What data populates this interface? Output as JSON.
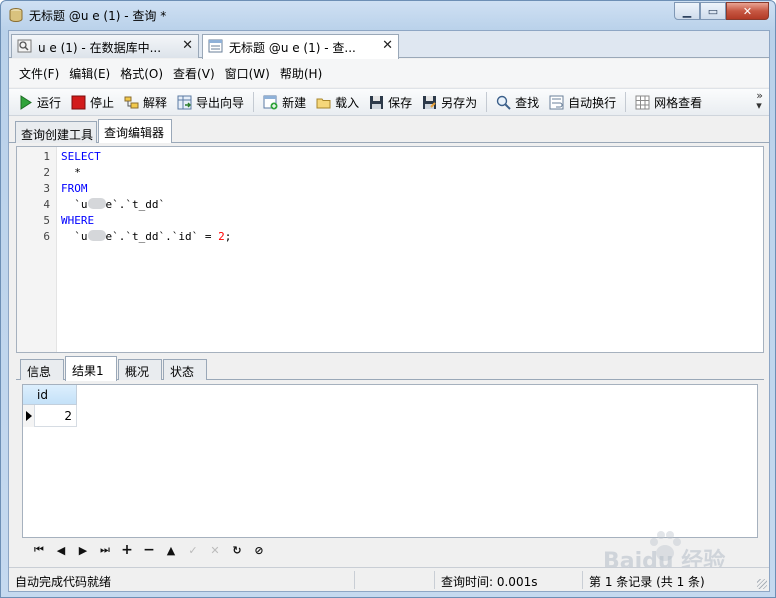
{
  "window": {
    "title": "无标题 @u    e (1) - 查询 *"
  },
  "doc_tabs": [
    {
      "label": "u    e (1) - 在数据库中...",
      "close": "✕"
    },
    {
      "label": "无标题 @u    e (1) - 查...",
      "close": "✕"
    }
  ],
  "menu": [
    "文件(F)",
    "编辑(E)",
    "格式(O)",
    "查看(V)",
    "窗口(W)",
    "帮助(H)"
  ],
  "toolbar": {
    "run": "运行",
    "stop": "停止",
    "explain": "解释",
    "export": "导出向导",
    "new": "新建",
    "load": "载入",
    "save": "保存",
    "save_as": "另存为",
    "find": "查找",
    "wrap": "自动换行",
    "grid_view": "网格查看"
  },
  "sub_tabs": [
    "查询创建工具",
    "查询编辑器"
  ],
  "editor": {
    "line_numbers": [
      "1",
      "2",
      "3",
      "4",
      "5",
      "6"
    ],
    "lines": {
      "l1": "SELECT",
      "l2": "  *",
      "l3": "FROM",
      "l4_pre": "  `u",
      "l4_post": "e`.`t_dd`",
      "l5": "WHERE",
      "l6_pre": "  `u",
      "l6_mid": "e`.`t_dd`.`id` = ",
      "l6_num": "2",
      "l6_end": ";"
    }
  },
  "result_tabs": [
    "信息",
    "结果1",
    "概况",
    "状态"
  ],
  "grid": {
    "column": "id",
    "value": "2"
  },
  "nav_buttons": [
    "⏮",
    "◀",
    "▶",
    "⏭",
    "+",
    "−",
    "▲",
    "✓",
    "✕",
    "↻",
    "⊘"
  ],
  "status": {
    "left": "自动完成代码就绪",
    "time": "查询时间: 0.001s",
    "records": "第 1 条记录 (共 1 条)"
  },
  "watermark": "Baidu 经验"
}
